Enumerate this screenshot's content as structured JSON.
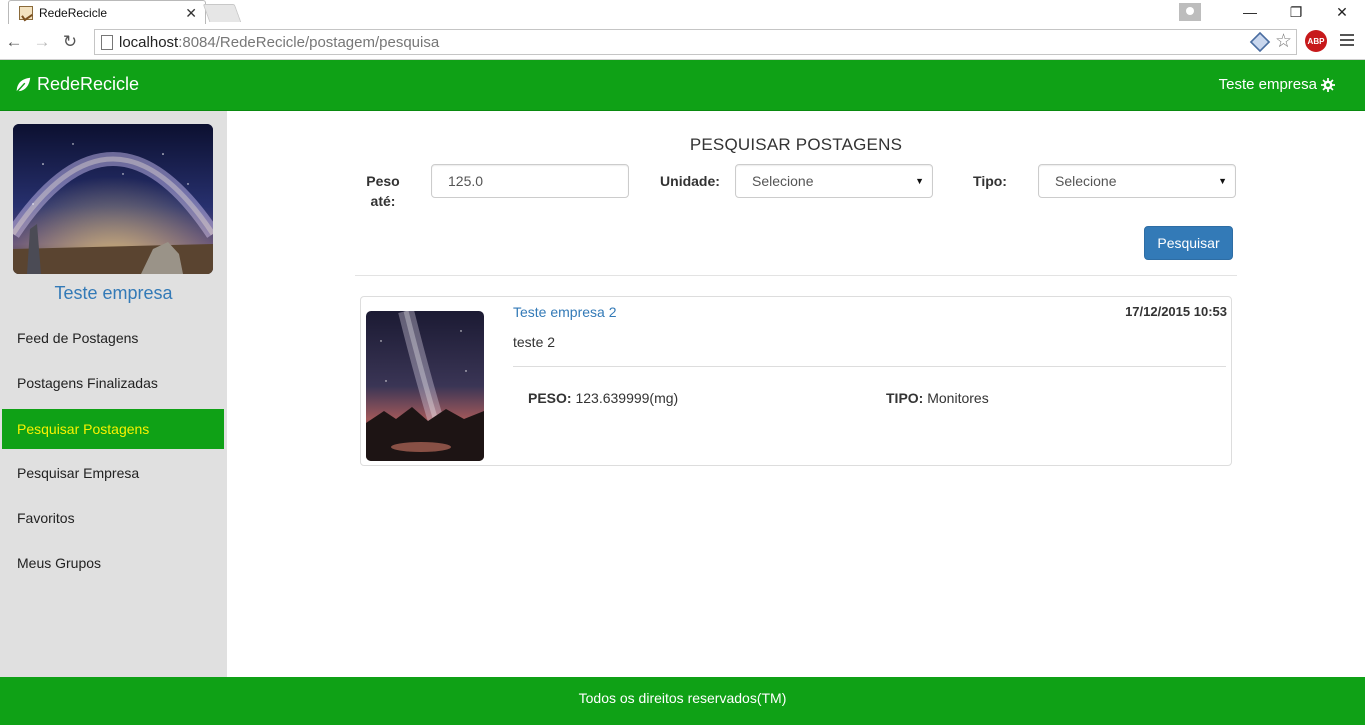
{
  "browser": {
    "tab_title": "RedeRecicle",
    "url_host": "localhost",
    "url_rest": ":8084/RedeRecicle/postagem/pesquisa",
    "abp_label": "ABP"
  },
  "navbar": {
    "brand": "RedeRecicle",
    "user": "Teste empresa"
  },
  "sidebar": {
    "profile_name": "Teste empresa",
    "items": [
      {
        "label": "Feed de Postagens"
      },
      {
        "label": "Postagens Finalizadas"
      },
      {
        "label": "Pesquisar Postagens"
      },
      {
        "label": "Pesquisar Empresa"
      },
      {
        "label": "Favoritos"
      },
      {
        "label": "Meus Grupos"
      }
    ],
    "active_index": 2
  },
  "search": {
    "title": "PESQUISAR POSTAGENS",
    "peso_label_line1": "Peso",
    "peso_label_line2": "até:",
    "peso_value": "125.0",
    "unidade_label": "Unidade:",
    "unidade_value": "Selecione",
    "tipo_label": "Tipo:",
    "tipo_value": "Selecione",
    "button": "Pesquisar"
  },
  "results": [
    {
      "author": "Teste empresa 2",
      "date": "17/12/2015 10:53",
      "text": "teste 2",
      "peso_label": "PESO:",
      "peso_value": "123.639999(mg)",
      "tipo_label": "TIPO:",
      "tipo_value": "Monitores"
    }
  ],
  "footer": {
    "text": "Todos os direitos reservados(TM)"
  },
  "colors": {
    "brand_green": "#0fa116",
    "link_blue": "#337ab7",
    "active_text": "#f8f200"
  }
}
